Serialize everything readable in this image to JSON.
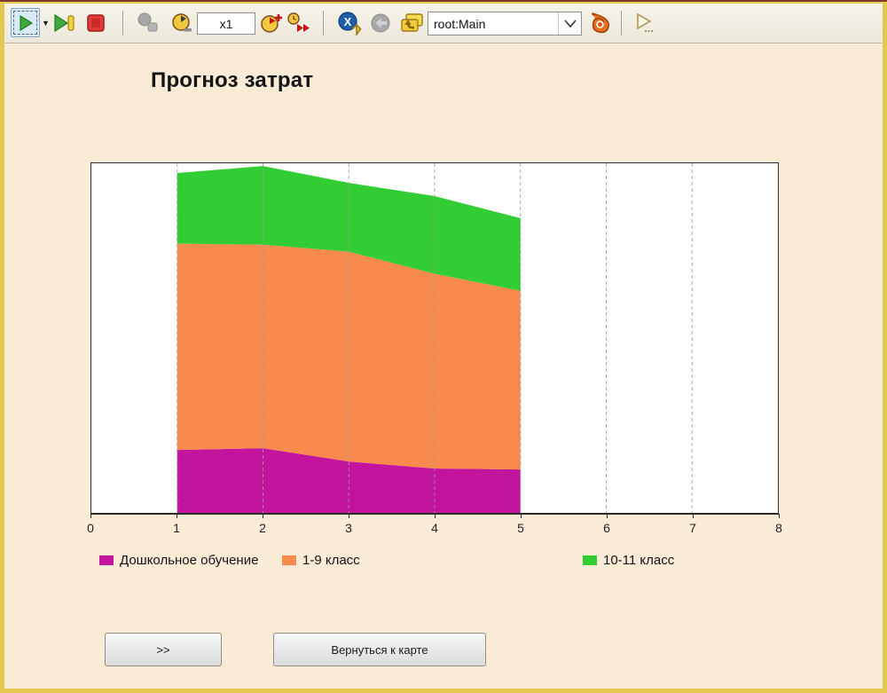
{
  "window": {
    "bg_color": "#FAEBD7",
    "frame_color": "#E4C74F"
  },
  "toolbar": {
    "speed_field": {
      "value": "x1"
    },
    "viewport_select": {
      "value": "root:Main"
    },
    "run_dropdown_glyph": "▼",
    "icon_names": [
      "run-icon",
      "run-dropdown-arrow",
      "step-run-icon",
      "stop-icon",
      "virtual-time-disabled-icon",
      "slow-down-icon",
      "speed-field",
      "speed-up-icon",
      "real-time-toggle-icon",
      "navigate-top-icon",
      "navigate-back-disabled-icon",
      "navigate-up-icon",
      "viewport-combobox",
      "anylogic-logo-icon",
      "run-experiment-icon"
    ]
  },
  "main": {
    "title": "Прогноз затрат",
    "buttons": {
      "forward_label": ">>",
      "back_to_map_label": "Вернуться к карте"
    }
  },
  "chart_data": {
    "type": "area",
    "stacked": true,
    "title": "Прогноз затрат",
    "x": [
      1,
      2,
      3,
      4,
      5
    ],
    "series": [
      {
        "name": "Дошкольное обучение",
        "color": "#C3149E",
        "values": [
          0.18,
          0.185,
          0.147,
          0.127,
          0.124
        ]
      },
      {
        "name": "1-9 класс",
        "color": "#F98A4D",
        "values": [
          0.59,
          0.582,
          0.6,
          0.557,
          0.511
        ]
      },
      {
        "name": "10-11 класс",
        "color": "#32CD32",
        "values": [
          0.202,
          0.225,
          0.197,
          0.222,
          0.208
        ]
      }
    ],
    "xlim": [
      0,
      8
    ],
    "ylim": [
      0,
      1
    ],
    "x_ticks": [
      0,
      1,
      2,
      3,
      4,
      5,
      6,
      7,
      8
    ],
    "y_axis_labels_visible": false,
    "grid": "vertical-dashed",
    "gridline_color": "#9C9C9C",
    "legend_position": "bottom"
  }
}
